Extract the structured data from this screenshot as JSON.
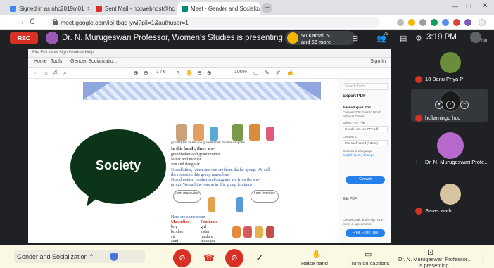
{
  "browser": {
    "tabs": [
      {
        "label": "Signed in as nhc2019m01",
        "color": "#4285f4"
      },
      {
        "label": "Sent Mail - hccwebhost@hccln",
        "color": "#d93025"
      },
      {
        "label": "Meet - Gender and Socializatio",
        "color": "#00897b"
      }
    ],
    "new_tab": "+",
    "window_controls": {
      "minimize": "—",
      "maximize": "☐",
      "close": "✕"
    },
    "back": "←",
    "forward": "→",
    "reload": "C",
    "url": "meet.google.com/ioi-tbqd-ywi?pli=1&authuser=1",
    "tab_close": "✕"
  },
  "meet": {
    "rec": "REC",
    "presenting_banner": "Dr. N. Murugeswari Professor, Women's Studies is presenting",
    "notification": {
      "line1": "50.Kamali N",
      "line2": "and 66 more"
    },
    "participants_count": "73",
    "time": "3:19 PM",
    "you": "You",
    "colors": {
      "rec": "#d93025",
      "dark": "#202124",
      "accent": "#8ab4f8"
    }
  },
  "doc": {
    "menu": "File  Edit  View  Sign  Window  Help",
    "tabs": [
      "Home",
      "Tools",
      "Gender Socializatio..."
    ],
    "sign_in": "Sign In",
    "page_indicator": "1  / 6",
    "zoom": "100%",
    "slide": {
      "title": "Society",
      "family_labels": [
        "grandfather  father      son    grandmother  mother  daughter"
      ],
      "lines": [
        {
          "text": "In this family, there are-",
          "style": "dk"
        },
        {
          "text": "grandfather and grandmother",
          "style": "dk"
        },
        {
          "text": "father and mother",
          "style": "dk"
        },
        {
          "text": "son and daughter",
          "style": "dk"
        },
        {
          "text": "Grandfather, father and son are from the he-group. We call",
          "style": "bl"
        },
        {
          "text": "the reason in this group masculine.",
          "style": "bl"
        },
        {
          "text": "Grandmother, mother and daughter are from the she-",
          "style": "bl"
        },
        {
          "text": "group. We call the reason in this group feminine.",
          "style": "bl"
        }
      ],
      "clouds": [
        "I am masculine",
        "I am feminine"
      ],
      "list_intro": "Here are some more-",
      "list_headers": [
        "Masculine",
        "Feminine"
      ],
      "list_rows": [
        [
          "boy",
          "girl"
        ],
        [
          "brother",
          "sister"
        ],
        [
          "sir",
          "madam"
        ],
        [
          "aunt",
          "mosaque"
        ]
      ]
    },
    "side_panel": {
      "search": "Search Tools",
      "export_title": "Export PDF",
      "adobe_title": "Adobe Export PDF",
      "adobe_desc1": "Convert PDF Files to Word",
      "adobe_desc2": "or Excel Online",
      "select_label": "Select PDF File",
      "file_value": "Gender Sc...on PPT.pdf",
      "convert_to": "Convert to",
      "format_value": "Microsoft Word (*.docx)",
      "language_label": "Document Language",
      "language_value": "English (U.S.)  Change",
      "convert_button": "Convert",
      "edit_pdf": "Edit PDF",
      "promo1": "Convert, edit and e-sign PDF",
      "promo2": "forms & agreements",
      "trial_button": "Free 7-Day Trial"
    }
  },
  "participants": [
    {
      "name": "18 Banu Priya P"
    },
    {
      "name": "hcflamingo hcc"
    },
    {
      "name": "Dr. N. Murugeswari Profe..."
    },
    {
      "name": "Saras wathi"
    }
  ],
  "bottom": {
    "meeting_name": "Gender and Socialization",
    "chevron": "^",
    "mic_off": "⊘",
    "end_call": "☎",
    "cam_off": "⊘",
    "check": "✓",
    "raise_hand": "Raise hand",
    "captions": "Turn on captions",
    "presenting_line1": "Dr. N. Murugeswari Professor...",
    "presenting_line2": "is presenting",
    "more": "⋮"
  }
}
